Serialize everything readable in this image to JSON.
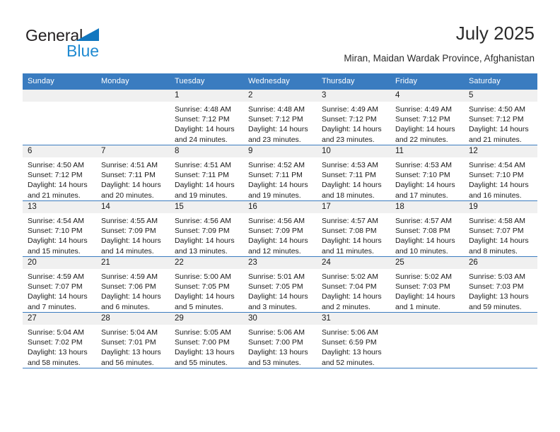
{
  "logo": {
    "word1": "General",
    "word2": "Blue",
    "triangle_color": "#1277bf",
    "word2_color": "#1f8ad1"
  },
  "header": {
    "title": "July 2025",
    "subtitle": "Miran, Maidan Wardak Province, Afghanistan"
  },
  "colors": {
    "header_row": "#3a7cc0",
    "daynum_band": "#f0f0f0",
    "grid_line": "#3a7cc0",
    "text": "#1a1a1a"
  },
  "calendar": {
    "weekday_headers": [
      "Sunday",
      "Monday",
      "Tuesday",
      "Wednesday",
      "Thursday",
      "Friday",
      "Saturday"
    ],
    "labels": {
      "sunrise": "Sunrise:",
      "sunset": "Sunset:",
      "daylight": "Daylight:"
    },
    "weeks": [
      [
        {
          "day": "",
          "blank": true,
          "sunrise": "",
          "sunset": "",
          "daylight": ""
        },
        {
          "day": "",
          "blank": true,
          "sunrise": "",
          "sunset": "",
          "daylight": ""
        },
        {
          "day": "1",
          "sunrise": "Sunrise: 4:48 AM",
          "sunset": "Sunset: 7:12 PM",
          "daylight": "Daylight: 14 hours and 24 minutes."
        },
        {
          "day": "2",
          "sunrise": "Sunrise: 4:48 AM",
          "sunset": "Sunset: 7:12 PM",
          "daylight": "Daylight: 14 hours and 23 minutes."
        },
        {
          "day": "3",
          "sunrise": "Sunrise: 4:49 AM",
          "sunset": "Sunset: 7:12 PM",
          "daylight": "Daylight: 14 hours and 23 minutes."
        },
        {
          "day": "4",
          "sunrise": "Sunrise: 4:49 AM",
          "sunset": "Sunset: 7:12 PM",
          "daylight": "Daylight: 14 hours and 22 minutes."
        },
        {
          "day": "5",
          "sunrise": "Sunrise: 4:50 AM",
          "sunset": "Sunset: 7:12 PM",
          "daylight": "Daylight: 14 hours and 21 minutes."
        }
      ],
      [
        {
          "day": "6",
          "sunrise": "Sunrise: 4:50 AM",
          "sunset": "Sunset: 7:12 PM",
          "daylight": "Daylight: 14 hours and 21 minutes."
        },
        {
          "day": "7",
          "sunrise": "Sunrise: 4:51 AM",
          "sunset": "Sunset: 7:11 PM",
          "daylight": "Daylight: 14 hours and 20 minutes."
        },
        {
          "day": "8",
          "sunrise": "Sunrise: 4:51 AM",
          "sunset": "Sunset: 7:11 PM",
          "daylight": "Daylight: 14 hours and 19 minutes."
        },
        {
          "day": "9",
          "sunrise": "Sunrise: 4:52 AM",
          "sunset": "Sunset: 7:11 PM",
          "daylight": "Daylight: 14 hours and 19 minutes."
        },
        {
          "day": "10",
          "sunrise": "Sunrise: 4:53 AM",
          "sunset": "Sunset: 7:11 PM",
          "daylight": "Daylight: 14 hours and 18 minutes."
        },
        {
          "day": "11",
          "sunrise": "Sunrise: 4:53 AM",
          "sunset": "Sunset: 7:10 PM",
          "daylight": "Daylight: 14 hours and 17 minutes."
        },
        {
          "day": "12",
          "sunrise": "Sunrise: 4:54 AM",
          "sunset": "Sunset: 7:10 PM",
          "daylight": "Daylight: 14 hours and 16 minutes."
        }
      ],
      [
        {
          "day": "13",
          "sunrise": "Sunrise: 4:54 AM",
          "sunset": "Sunset: 7:10 PM",
          "daylight": "Daylight: 14 hours and 15 minutes."
        },
        {
          "day": "14",
          "sunrise": "Sunrise: 4:55 AM",
          "sunset": "Sunset: 7:09 PM",
          "daylight": "Daylight: 14 hours and 14 minutes."
        },
        {
          "day": "15",
          "sunrise": "Sunrise: 4:56 AM",
          "sunset": "Sunset: 7:09 PM",
          "daylight": "Daylight: 14 hours and 13 minutes."
        },
        {
          "day": "16",
          "sunrise": "Sunrise: 4:56 AM",
          "sunset": "Sunset: 7:09 PM",
          "daylight": "Daylight: 14 hours and 12 minutes."
        },
        {
          "day": "17",
          "sunrise": "Sunrise: 4:57 AM",
          "sunset": "Sunset: 7:08 PM",
          "daylight": "Daylight: 14 hours and 11 minutes."
        },
        {
          "day": "18",
          "sunrise": "Sunrise: 4:57 AM",
          "sunset": "Sunset: 7:08 PM",
          "daylight": "Daylight: 14 hours and 10 minutes."
        },
        {
          "day": "19",
          "sunrise": "Sunrise: 4:58 AM",
          "sunset": "Sunset: 7:07 PM",
          "daylight": "Daylight: 14 hours and 8 minutes."
        }
      ],
      [
        {
          "day": "20",
          "sunrise": "Sunrise: 4:59 AM",
          "sunset": "Sunset: 7:07 PM",
          "daylight": "Daylight: 14 hours and 7 minutes."
        },
        {
          "day": "21",
          "sunrise": "Sunrise: 4:59 AM",
          "sunset": "Sunset: 7:06 PM",
          "daylight": "Daylight: 14 hours and 6 minutes."
        },
        {
          "day": "22",
          "sunrise": "Sunrise: 5:00 AM",
          "sunset": "Sunset: 7:05 PM",
          "daylight": "Daylight: 14 hours and 5 minutes."
        },
        {
          "day": "23",
          "sunrise": "Sunrise: 5:01 AM",
          "sunset": "Sunset: 7:05 PM",
          "daylight": "Daylight: 14 hours and 3 minutes."
        },
        {
          "day": "24",
          "sunrise": "Sunrise: 5:02 AM",
          "sunset": "Sunset: 7:04 PM",
          "daylight": "Daylight: 14 hours and 2 minutes."
        },
        {
          "day": "25",
          "sunrise": "Sunrise: 5:02 AM",
          "sunset": "Sunset: 7:03 PM",
          "daylight": "Daylight: 14 hours and 1 minute."
        },
        {
          "day": "26",
          "sunrise": "Sunrise: 5:03 AM",
          "sunset": "Sunset: 7:03 PM",
          "daylight": "Daylight: 13 hours and 59 minutes."
        }
      ],
      [
        {
          "day": "27",
          "sunrise": "Sunrise: 5:04 AM",
          "sunset": "Sunset: 7:02 PM",
          "daylight": "Daylight: 13 hours and 58 minutes."
        },
        {
          "day": "28",
          "sunrise": "Sunrise: 5:04 AM",
          "sunset": "Sunset: 7:01 PM",
          "daylight": "Daylight: 13 hours and 56 minutes."
        },
        {
          "day": "29",
          "sunrise": "Sunrise: 5:05 AM",
          "sunset": "Sunset: 7:00 PM",
          "daylight": "Daylight: 13 hours and 55 minutes."
        },
        {
          "day": "30",
          "sunrise": "Sunrise: 5:06 AM",
          "sunset": "Sunset: 7:00 PM",
          "daylight": "Daylight: 13 hours and 53 minutes."
        },
        {
          "day": "31",
          "sunrise": "Sunrise: 5:06 AM",
          "sunset": "Sunset: 6:59 PM",
          "daylight": "Daylight: 13 hours and 52 minutes."
        },
        {
          "day": "",
          "blank": true,
          "sunrise": "",
          "sunset": "",
          "daylight": ""
        },
        {
          "day": "",
          "blank": true,
          "sunrise": "",
          "sunset": "",
          "daylight": ""
        }
      ]
    ]
  }
}
